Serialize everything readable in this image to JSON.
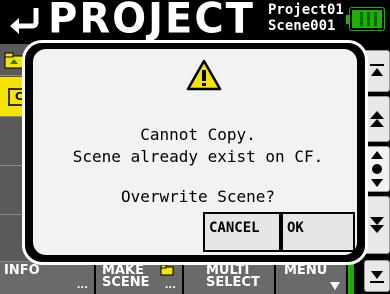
{
  "header": {
    "title": "PROJECT",
    "project_name": "Project01",
    "scene_name": "Scene001",
    "battery_color": "#1db000"
  },
  "left": {
    "box_label": "C"
  },
  "dialog": {
    "line1": "Cannot Copy.",
    "line2": "Scene already exist on CF.",
    "line3": "Overwrite Scene?",
    "cancel_label": "CANCEL",
    "ok_label": "OK",
    "warning_icon": "warning-icon"
  },
  "footer": {
    "f1_label": "INFO",
    "f2_label_1": "MAKE",
    "f2_label_2": "SCENE",
    "f3_label_1": "MULTI",
    "f3_label_2": "SELECT",
    "f4_label": "MENU",
    "dots": "..."
  },
  "colors": {
    "accent": "#f4e400",
    "battery": "#1db000"
  }
}
